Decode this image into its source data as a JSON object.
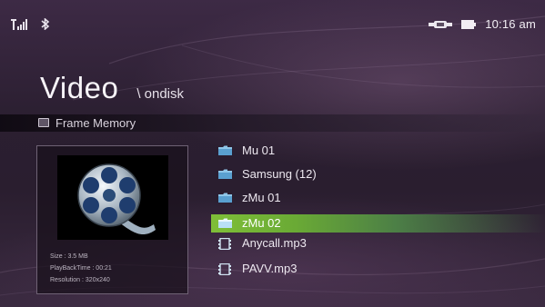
{
  "status": {
    "time": "10:16 am",
    "icons": [
      "signal-icon",
      "bluetooth-icon",
      "usb-icon",
      "battery-icon"
    ]
  },
  "header": {
    "title": "Video",
    "path": "\\ ondisk"
  },
  "subbar": {
    "label": "Frame Memory"
  },
  "preview": {
    "size": "Size : 3.5 MB",
    "playback": "PlayBackTime : 00:21",
    "resolution": "Resolution : 320x240",
    "icon": "film-reel-icon"
  },
  "files": [
    {
      "label": "Mu 01",
      "type": "folder",
      "selected": false
    },
    {
      "label": "Samsung (12)",
      "type": "folder",
      "selected": false
    },
    {
      "label": "zMu 01",
      "type": "folder",
      "selected": false
    },
    {
      "label": "zMu 02",
      "type": "folder",
      "selected": true
    },
    {
      "label": "Anycall.mp3",
      "type": "media",
      "selected": false
    },
    {
      "label": "PAVV.mp3",
      "type": "media",
      "selected": false
    }
  ],
  "colors": {
    "background": "#2b1f31",
    "selection": "#7fbf38",
    "folder": "#8fc6e8"
  }
}
